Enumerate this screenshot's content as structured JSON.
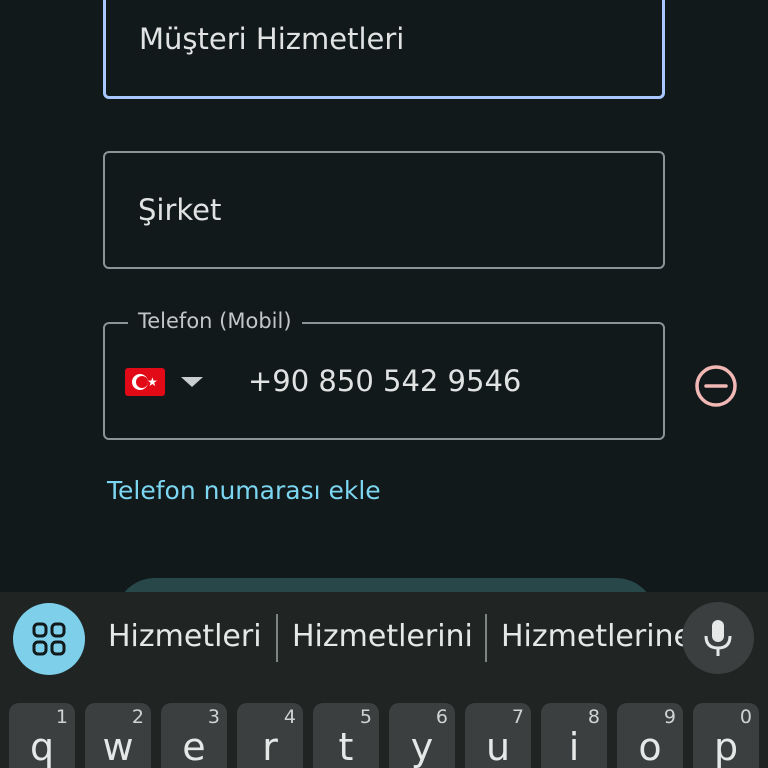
{
  "form": {
    "department_value": "Müşteri Hizmetleri",
    "company_placeholder": "Şirket",
    "phone": {
      "label": "Telefon (Mobil)",
      "country_flag": "turkey-flag",
      "number": "+90 850 542 9546"
    },
    "add_phone_link": "Telefon numarası ekle"
  },
  "keyboard": {
    "suggestions": [
      "Hizmetleri",
      "Hizmetlerini",
      "Hizmetlerine"
    ],
    "row1": [
      {
        "letter": "q",
        "hint": "1"
      },
      {
        "letter": "w",
        "hint": "2"
      },
      {
        "letter": "e",
        "hint": "3"
      },
      {
        "letter": "r",
        "hint": "4"
      },
      {
        "letter": "t",
        "hint": "5"
      },
      {
        "letter": "y",
        "hint": "6"
      },
      {
        "letter": "u",
        "hint": "7"
      },
      {
        "letter": "i",
        "hint": "8"
      },
      {
        "letter": "o",
        "hint": "9"
      },
      {
        "letter": "p",
        "hint": "0"
      }
    ]
  },
  "colors": {
    "background": "#11191b",
    "focus_border": "#a9c7ff",
    "link": "#7dd6f1",
    "remove_icon": "#f2b8b5",
    "keyboard_background": "#202524",
    "key_background": "#3b3f3f",
    "apps_button": "#7dcfea"
  },
  "icons": {
    "remove": "minus-circle-icon",
    "dropdown": "chevron-down-icon",
    "apps": "apps-grid-icon",
    "mic": "microphone-icon"
  }
}
